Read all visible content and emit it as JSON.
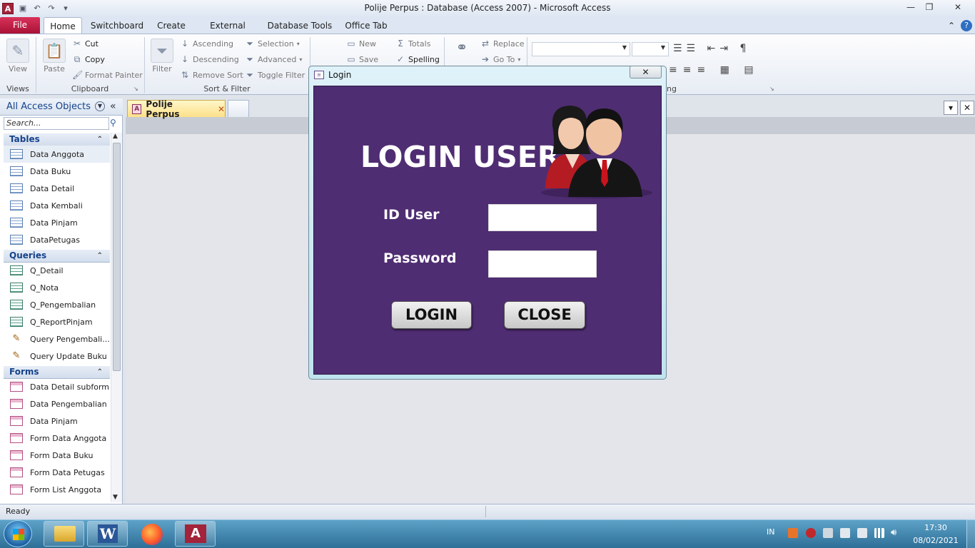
{
  "window": {
    "title": "Polije Perpus : Database (Access 2007)  -  Microsoft Access",
    "minimize": "—",
    "restore": "❐",
    "close": "✕"
  },
  "ribbon_tabs": {
    "file": "File",
    "home": "Home",
    "switchboard": "Switchboard",
    "create": "Create",
    "external": "External Data",
    "dbtools": "Database Tools",
    "officetab": "Office Tab"
  },
  "ribbon": {
    "views": {
      "view": "View",
      "group": "Views"
    },
    "clipboard": {
      "paste": "Paste",
      "cut": "Cut",
      "copy": "Copy",
      "format_painter": "Format Painter",
      "group": "Clipboard"
    },
    "sort_filter": {
      "filter": "Filter",
      "ascending": "Ascending",
      "descending": "Descending",
      "remove_sort": "Remove Sort",
      "selection": "Selection",
      "advanced": "Advanced",
      "toggle_filter": "Toggle Filter",
      "group": "Sort & Filter"
    },
    "records": {
      "new": "New",
      "save": "Save",
      "totals": "Totals",
      "spelling": "Spelling"
    },
    "find": {
      "replace": "Replace",
      "goto": "Go To"
    },
    "formatting": {
      "group_partial": "ng"
    }
  },
  "nav": {
    "title": "All Access Objects",
    "search_placeholder": "Search...",
    "sections": [
      {
        "name": "Tables",
        "items": [
          "Data Anggota",
          "Data Buku",
          "Data Detail",
          "Data Kembali",
          "Data Pinjam",
          "DataPetugas"
        ]
      },
      {
        "name": "Queries",
        "items": [
          "Q_Detail",
          "Q_Nota",
          "Q_Pengembalian",
          "Q_ReportPinjam",
          "Query Pengembali...",
          "Query Update Buku"
        ]
      },
      {
        "name": "Forms",
        "items": [
          "Data Detail subform",
          "Data Pengembalian",
          "Data Pinjam",
          "Form Data Anggota",
          "Form Data Buku",
          "Form Data Petugas",
          "Form List Anggota"
        ]
      }
    ]
  },
  "doc_tab": {
    "label": "Polije Perpus",
    "close": "✕"
  },
  "dialog": {
    "caption": "Login",
    "close": "✕",
    "heading": "LOGIN USER",
    "id_label": "ID User",
    "password_label": "Password",
    "id_value": "",
    "password_value": "",
    "login_button": "LOGIN",
    "close_button": "CLOSE"
  },
  "status": {
    "text": "Ready"
  },
  "taskbar": {
    "lang": "IN",
    "time": "17:30",
    "date": "08/02/2021"
  },
  "colors": {
    "dialog_bg": "#4f2d72",
    "file_tab": "#c21d47",
    "doc_tab": "#fde18a"
  }
}
